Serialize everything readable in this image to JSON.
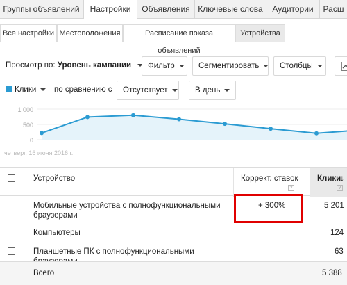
{
  "tabs": [
    {
      "label": "Группы объявлений"
    },
    {
      "label": "Настройки"
    },
    {
      "label": "Объявления"
    },
    {
      "label": "Ключевые слова"
    },
    {
      "label": "Аудитории"
    },
    {
      "label": "Расш"
    }
  ],
  "subtabs": [
    {
      "label": "Все настройки"
    },
    {
      "label": "Местоположения"
    },
    {
      "label": "Расписание показа объявлений"
    },
    {
      "label": "Устройства"
    }
  ],
  "toolbar": {
    "view_prefix": "Просмотр по:",
    "view_value": "Уровень кампании",
    "filter": "Фильтр",
    "segment": "Сегментировать",
    "columns": "Столбцы"
  },
  "metrics_bar": {
    "metric": "Клики",
    "compare_label": "по сравнению с",
    "compare_value": "Отсутствует",
    "period": "В день"
  },
  "chart_data": {
    "type": "area",
    "y_ticks": [
      "1 000",
      "500",
      "0"
    ],
    "ylim": [
      0,
      1000
    ],
    "x_label": "четверг, 16 июня 2016 г.",
    "series": [
      {
        "values": [
          220,
          740,
          800,
          670,
          520,
          360,
          210,
          300
        ]
      }
    ],
    "colors": {
      "line": "#2b9bd2",
      "fill": "#e5f3fa"
    }
  },
  "table": {
    "headers": {
      "device": "Устройство",
      "bid_adj": "Коррект. ставок",
      "clicks": "Клики"
    },
    "rows": [
      {
        "device_line1": "Мобильные устройства с полнофункциональными",
        "device_line2": "браузерами",
        "bid_adj": "+ 300%",
        "clicks": "5 201"
      },
      {
        "device_line1": "Компьютеры",
        "device_line2": "",
        "bid_adj": "",
        "clicks": "124"
      },
      {
        "device_line1": "Планшетные ПК с полнофункциональными",
        "device_line2": "браузерами",
        "bid_adj": "",
        "clicks": "63"
      }
    ],
    "total": {
      "label": "Всего",
      "clicks": "5 388"
    }
  }
}
